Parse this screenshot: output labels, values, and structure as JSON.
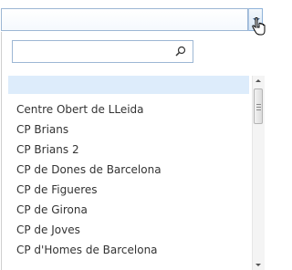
{
  "combobox": {
    "value": "",
    "button_icon": "chevron-down-icon"
  },
  "dropdown": {
    "search": {
      "value": "",
      "placeholder": "",
      "icon": "search-icon"
    },
    "items": [
      {
        "label": ""
      },
      {
        "label": "Centre Obert de LLeida"
      },
      {
        "label": "CP Brians"
      },
      {
        "label": "CP Brians 2"
      },
      {
        "label": "CP de Dones de Barcelona"
      },
      {
        "label": "CP de Figueres"
      },
      {
        "label": "CP de Girona"
      },
      {
        "label": "CP de Joves"
      },
      {
        "label": "CP d'Homes de Barcelona"
      }
    ]
  },
  "colors": {
    "field_border": "#9db7d4",
    "highlight": "#ddecfb",
    "text": "#333333"
  }
}
